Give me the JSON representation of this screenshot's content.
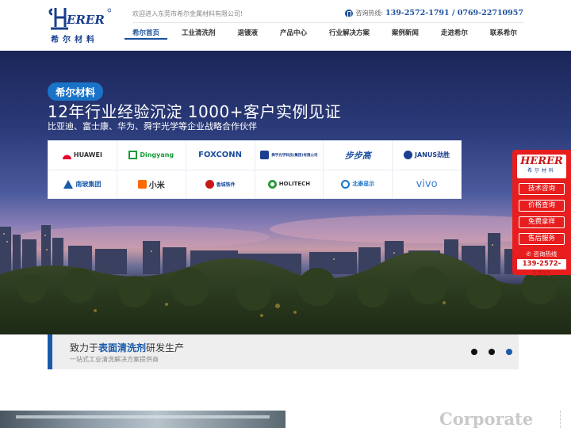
{
  "header": {
    "logo": {
      "mark": "HERER",
      "sub": "希尔材料"
    },
    "welcome": "欢迎进入东莞市希尔金属材料有限公司!",
    "hotline_label": "咨询热线:",
    "hotline_numbers": "139-2572-1791 / 0769-22710957",
    "nav": [
      {
        "label": "希尔首页",
        "active": true
      },
      {
        "label": "工业清洗剂"
      },
      {
        "label": "退镀液"
      },
      {
        "label": "产品中心"
      },
      {
        "label": "行业解决方案"
      },
      {
        "label": "案例新闻"
      },
      {
        "label": "走进希尔"
      },
      {
        "label": "联系希尔"
      }
    ]
  },
  "banner": {
    "tag": "希尔材料",
    "headline": "12年行业经验沉淀  1000+客户实例见证",
    "subtitle": "比亚迪、富士康、华为、舜宇光学等企业战略合作伙伴",
    "brands": [
      {
        "name": "HUAWEI",
        "color": "#e4002b"
      },
      {
        "name": "Dingyang",
        "color": "#1a9a3c"
      },
      {
        "name": "FOXCONN",
        "color": "#1a4f9c"
      },
      {
        "name": "舜宇光学科技(集团)有限公司",
        "color": "#1a3f8f"
      },
      {
        "name": "步步高",
        "color": "#1a4f9c"
      },
      {
        "name": "JANUS劲胜",
        "color": "#1a3f8f"
      },
      {
        "name": "南玻集团",
        "color": "#1a5aab"
      },
      {
        "name": "小米",
        "color": "#ff6900"
      },
      {
        "name": "香城铁件",
        "color": "#c81818"
      },
      {
        "name": "HOLITECH",
        "color": "#2a9a3c"
      },
      {
        "name": "北泰显示",
        "color": "#1a73c8"
      },
      {
        "name": "vivo",
        "color": "#3a7fd0"
      }
    ]
  },
  "side_widget": {
    "logo": {
      "mark": "HERER",
      "sub": "希尔材料"
    },
    "buttons": [
      "技术咨询",
      "价格查询",
      "免费拿样",
      "售后服务"
    ],
    "hotline_label": "咨询热线",
    "hotline_number": "139-2572-1791"
  },
  "tagline": {
    "prefix": "致力于",
    "highlight": "表面清洗剂",
    "suffix": "研发生产",
    "sub": "一站式工业清洗解决方案提供商",
    "slides": 3,
    "active_slide": 3
  },
  "bottom": {
    "heading": "Corporate"
  },
  "colors": {
    "brand_blue": "#1a5aab",
    "side_red": "#e81e1e",
    "logo_red": "#c81818"
  }
}
